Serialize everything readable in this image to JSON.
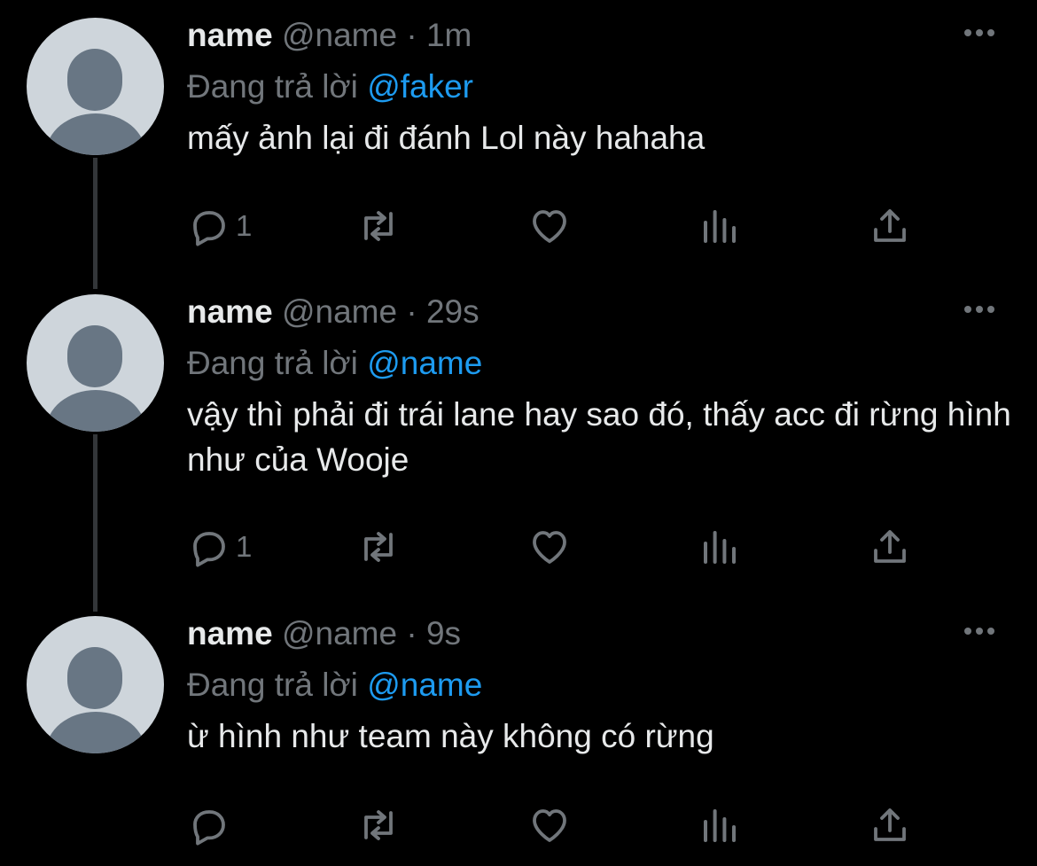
{
  "tweets": [
    {
      "name": "name",
      "handle": "@name",
      "dot": "·",
      "time": "1m",
      "reply_prefix": "Đang trả lời",
      "reply_to": "@faker",
      "text": "mấy ảnh lại đi đánh Lol này hahaha",
      "reply_count": "1"
    },
    {
      "name": "name",
      "handle": "@name",
      "dot": "·",
      "time": "29s",
      "reply_prefix": "Đang trả lời",
      "reply_to": "@name",
      "text": "vậy thì phải đi trái lane hay sao đó, thấy acc đi rừng hình như của Wooje",
      "reply_count": "1"
    },
    {
      "name": "name",
      "handle": "@name",
      "dot": "·",
      "time": "9s",
      "reply_prefix": "Đang trả lời",
      "reply_to": "@name",
      "text": "ừ hình như team này không có rừng",
      "reply_count": ""
    }
  ],
  "icons": {
    "reply": "reply-icon",
    "retweet": "retweet-icon",
    "like": "heart-icon",
    "views": "analytics-icon",
    "share": "share-icon",
    "more": "more-icon",
    "avatar": "default-avatar"
  },
  "colors": {
    "background": "#000000",
    "text": "#e7e9ea",
    "muted": "#71767b",
    "mention": "#1d9bf0",
    "thread_line": "#333639"
  }
}
